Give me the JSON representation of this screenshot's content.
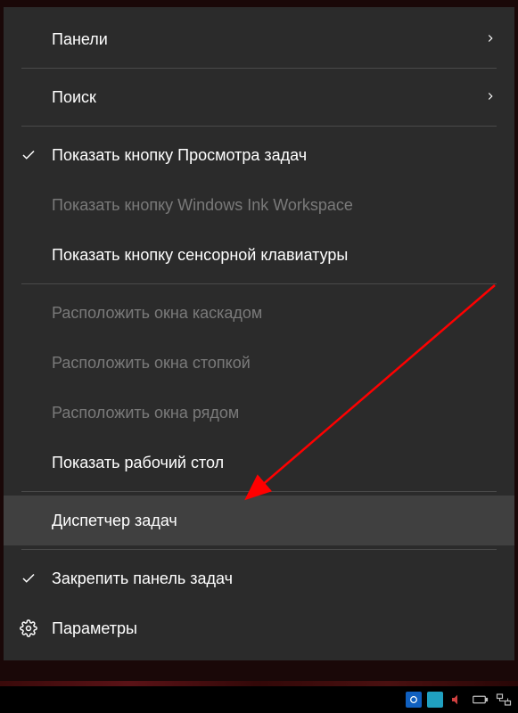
{
  "menu": {
    "items": [
      {
        "label": "Панели",
        "hasSubmenu": true
      },
      {
        "separator": true
      },
      {
        "label": "Поиск",
        "hasSubmenu": true
      },
      {
        "separator": true
      },
      {
        "label": "Показать кнопку Просмотра задач",
        "checked": true
      },
      {
        "label": "Показать кнопку Windows Ink Workspace",
        "disabled": true
      },
      {
        "label": "Показать кнопку сенсорной клавиатуры"
      },
      {
        "separator": true
      },
      {
        "label": "Расположить окна каскадом",
        "disabled": true
      },
      {
        "label": "Расположить окна стопкой",
        "disabled": true
      },
      {
        "label": "Расположить окна рядом",
        "disabled": true
      },
      {
        "label": "Показать рабочий стол"
      },
      {
        "separator": true
      },
      {
        "label": "Диспетчер задач",
        "highlighted": true
      },
      {
        "separator": true
      },
      {
        "label": "Закрепить панель задач",
        "checked": true
      },
      {
        "label": "Параметры",
        "icon": "gear"
      }
    ]
  }
}
